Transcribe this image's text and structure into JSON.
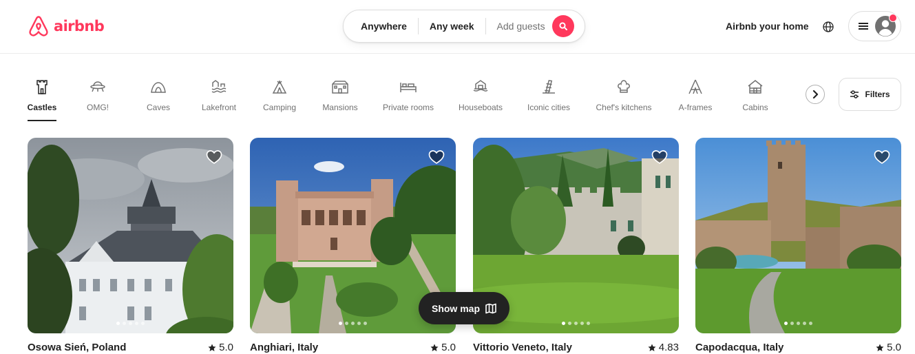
{
  "brand": {
    "logo_text": "airbnb",
    "color": "#ff385c"
  },
  "search": {
    "where": "Anywhere",
    "when": "Any week",
    "who": "Add guests",
    "button_icon": "search-icon"
  },
  "header": {
    "host_link": "Airbnb your home",
    "globe_icon": "globe-icon",
    "menu_icon": "hamburger-menu-icon",
    "avatar_icon": "user-avatar-icon",
    "notification_color": "#ff385c"
  },
  "categories": [
    {
      "label": "Castles",
      "icon": "castle-icon",
      "active": true
    },
    {
      "label": "OMG!",
      "icon": "ufo-house-icon",
      "active": false
    },
    {
      "label": "Caves",
      "icon": "cave-icon",
      "active": false
    },
    {
      "label": "Lakefront",
      "icon": "lakefront-icon",
      "active": false
    },
    {
      "label": "Camping",
      "icon": "tent-icon",
      "active": false
    },
    {
      "label": "Mansions",
      "icon": "mansion-icon",
      "active": false
    },
    {
      "label": "Private rooms",
      "icon": "bed-icon",
      "active": false
    },
    {
      "label": "Houseboats",
      "icon": "houseboat-icon",
      "active": false
    },
    {
      "label": "Iconic cities",
      "icon": "leaning-tower-icon",
      "active": false
    },
    {
      "label": "Chef's kitchens",
      "icon": "chef-hat-icon",
      "active": false
    },
    {
      "label": "A-frames",
      "icon": "a-frame-icon",
      "active": false
    },
    {
      "label": "Cabins",
      "icon": "cabin-icon",
      "active": false
    }
  ],
  "category_nav": {
    "next_icon": "chevron-right-icon"
  },
  "filters": {
    "label": "Filters",
    "icon": "sliders-icon"
  },
  "listings": [
    {
      "location": "Osowa Sień, Poland",
      "rating": "5.0",
      "photo_count": 5,
      "active_photo": 0
    },
    {
      "location": "Anghiari, Italy",
      "rating": "5.0",
      "photo_count": 5,
      "active_photo": 0
    },
    {
      "location": "Vittorio Veneto, Italy",
      "rating": "4.83",
      "photo_count": 5,
      "active_photo": 0
    },
    {
      "location": "Capodacqua, Italy",
      "rating": "5.0",
      "photo_count": 5,
      "active_photo": 0
    }
  ],
  "map_toggle": {
    "label": "Show map",
    "icon": "map-icon"
  }
}
